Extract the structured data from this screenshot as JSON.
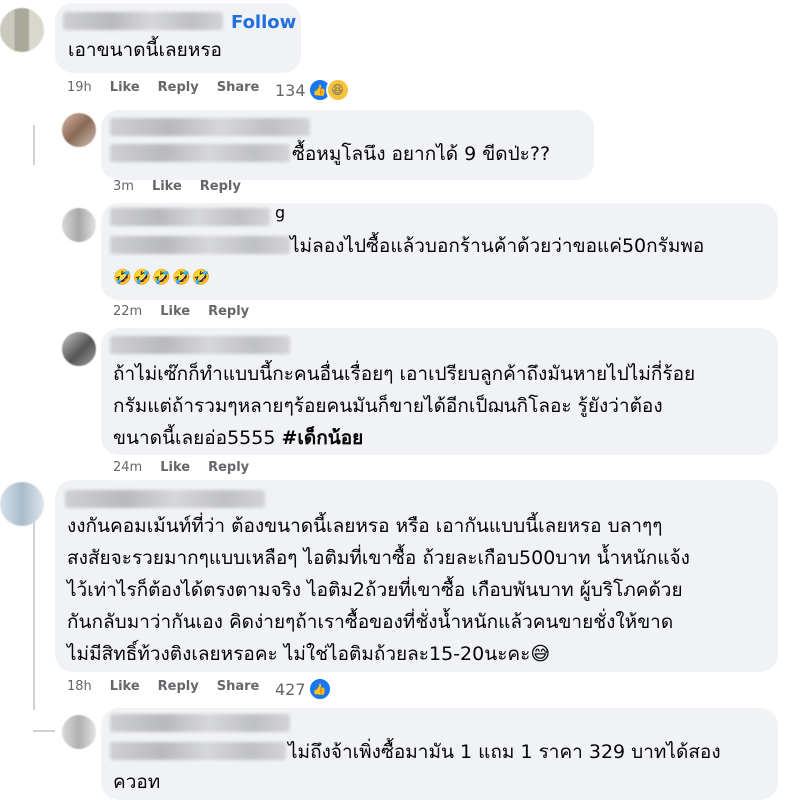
{
  "comments": [
    {
      "text": "เอาขนาดนี้เลยหรอ",
      "follow": "Follow",
      "meta": {
        "time": "19h",
        "like": "Like",
        "reply": "Reply",
        "share": "Share"
      },
      "reactions": {
        "count": "134"
      }
    },
    {
      "text": "ซื้อหมูโลนึง อยากได้ 9 ขีดป่ะ??",
      "meta": {
        "time": "3m",
        "like": "Like",
        "reply": "Reply"
      }
    },
    {
      "text": "ไม่ลองไปซื้อแล้วบอกร้านค้าด้วยว่าขอแค่50กรัมพอ",
      "name_tail": "g",
      "emojis": "🤣🤣🤣🤣🤣",
      "meta": {
        "time": "22m",
        "like": "Like",
        "reply": "Reply"
      }
    },
    {
      "lines": [
        "ถ้าไม่เซ๊กก็ทำแบบนี้กะคนอื่นเรื่อยๆ เอาเปรียบลูกค้าถึงมันหายไปไม่กี่ร้อย",
        "กรัมแต่ถ้ารวมๆหลายๆร้อยคนมันก็ขายได้อีกเป็ฌนกิโลอะ รู้ยังว่าต้อง",
        "ขนาดนี้เลยอ่อ5555 "
      ],
      "hashtag": "#เด็กน้อย",
      "meta": {
        "time": "24m",
        "like": "Like",
        "reply": "Reply"
      }
    },
    {
      "lines": [
        "งงกันคอมเม้นท์ที่ว่า ต้องขนาดนี้เลยหรอ หรือ เอากันแบบนี้เลยหรอ บลาๆๆ",
        "สงสัยจะรวยมากๆแบบเหลือๆ ไอติมที่เขาซื้อ ถ้วยละเกือบ500บาท น้ำหนักแจ้ง",
        "ไว้เท่าไรก็ต้องได้ตรงตามจริง ไอติม2ถ้วยที่เขาซื้อ เกือบพันบาท ผู้บริโภคด้วย",
        "กันกลับมาว่ากันเอง คิดง่ายๆถ้าเราซื้อของที่ชั่งน้ำหนักแล้วคนขายชั่งให้ขาด",
        "ไม่มีสิทธิ์ท้วงติงเลยหรอคะ ไม่ใช่ไอติมถ้วยละ15-20นะคะ😅"
      ],
      "meta": {
        "time": "18h",
        "like": "Like",
        "reply": "Reply",
        "share": "Share"
      },
      "reactions": {
        "count": "427"
      }
    },
    {
      "lines": [
        "ไม่ถึงจ้าเพิ่งซื้อมามัน 1 แถม 1 ราคา 329 บาทได้สอง",
        "ควอท"
      ]
    }
  ],
  "icons": {
    "like": "thumbs-up",
    "haha": "laughing-face",
    "like_color": "#1877f2",
    "link_color": "#216fdb",
    "bubble_color": "#f0f2f5",
    "meta_color": "#65676b"
  }
}
